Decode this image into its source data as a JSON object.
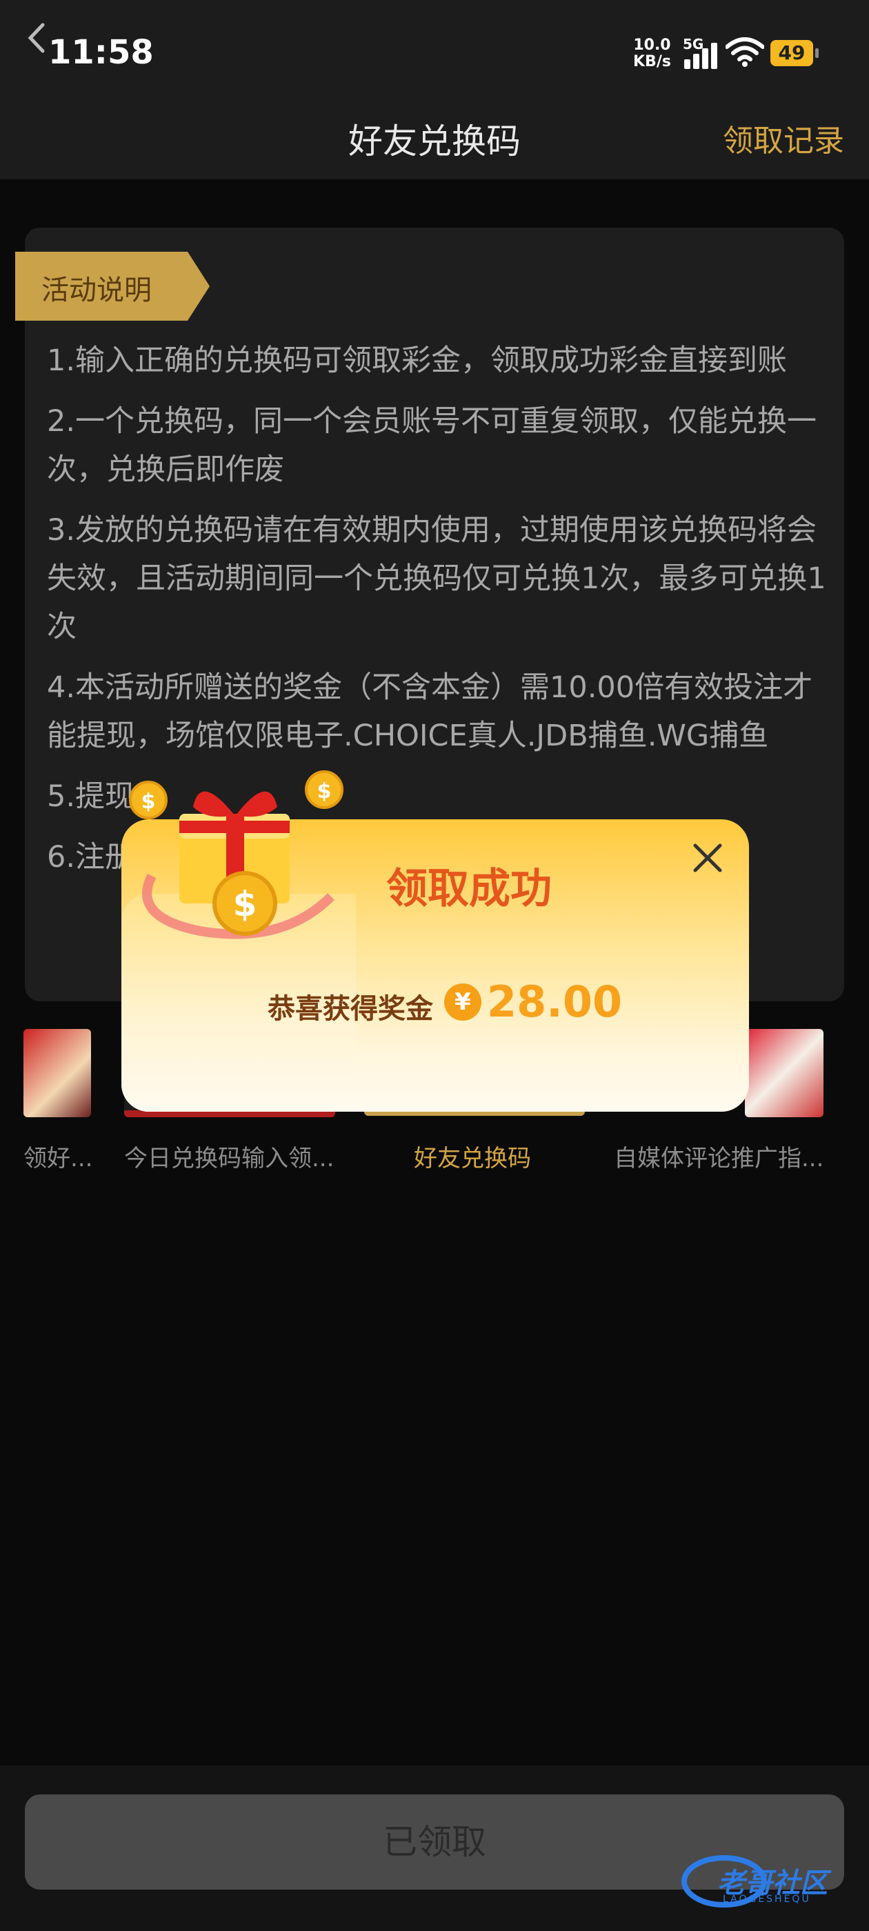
{
  "status_bar": {
    "time": "11:58",
    "net_speed": "10.0",
    "net_unit": "KB/s",
    "network": "5G",
    "battery": "49"
  },
  "nav": {
    "title": "好友兑换码",
    "right_link": "领取记录",
    "back_icon": "chevron-left-icon"
  },
  "activity": {
    "tag": "活动说明",
    "rules": [
      "1.输入正确的兑换码可领取彩金，领取成功彩金直接到账",
      "2.一个兑换码，同一个会员账号不可重复领取，仅能兑换一次，兑换后即作废",
      "3.发放的兑换码请在有效期内使用，过期使用该兑换码将会失效，且活动期间同一个兑换码仅可兑换1次，最多可兑换1次",
      "4.本活动所赠送的奖金（不含本金）需10.00倍有效投注才能提现，场馆仅限电子.CHOICE真人.JDB捕鱼.WG捕鱼",
      "5.提现",
      "6.注册"
    ]
  },
  "tabs": [
    {
      "label": "领好..."
    },
    {
      "label": "今日兑换码输入领..."
    },
    {
      "label": "好友兑换码"
    },
    {
      "label": "自媒体评论推广指..."
    }
  ],
  "modal": {
    "title": "领取成功",
    "congrats": "恭喜获得奖金",
    "currency_symbol": "¥",
    "amount": "28.00",
    "close_icon": "close-icon",
    "gift_icon": "gift-box-icon"
  },
  "bottom": {
    "button_label": "已领取"
  },
  "watermark": {
    "text": "老哥社区",
    "sub": "LAOGESHEQU"
  },
  "colors": {
    "accent_gold": "#d4a542",
    "modal_title": "#e4571c",
    "amount": "#f7a11c"
  }
}
